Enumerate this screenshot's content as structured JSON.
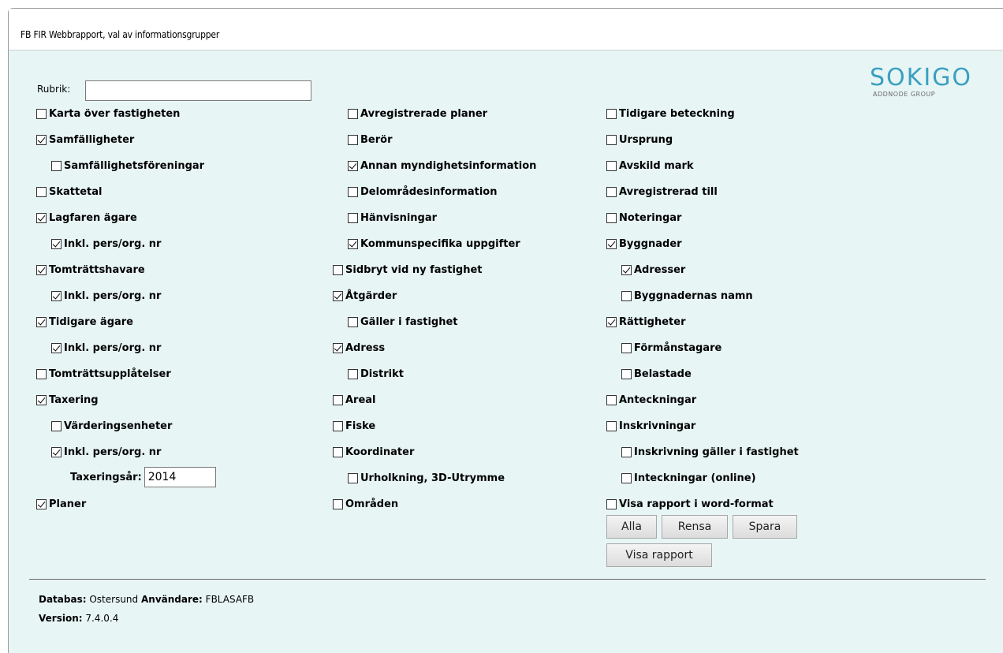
{
  "title": "FB FIR Webbrapport, val av informationsgrupper",
  "logo": {
    "word": "SOKIGO",
    "sub": "ADDNODE GROUP"
  },
  "rubrik": {
    "label": "Rubrik:",
    "value": ""
  },
  "col1": [
    {
      "label": "Karta över fastigheten",
      "checked": false
    },
    {
      "label": "Samfälligheter",
      "checked": true
    },
    {
      "label": "Samfällighetsföreningar",
      "checked": false
    },
    {
      "label": "Skattetal",
      "checked": false
    },
    {
      "label": "Lagfaren ägare",
      "checked": true
    },
    {
      "label": "Inkl. pers/org. nr",
      "checked": true
    },
    {
      "label": "Tomträttshavare",
      "checked": true
    },
    {
      "label": "Inkl. pers/org. nr",
      "checked": true
    },
    {
      "label": "Tidigare ägare",
      "checked": true
    },
    {
      "label": "Inkl. pers/org. nr",
      "checked": true
    },
    {
      "label": "Tomträttsupplåtelser",
      "checked": false
    },
    {
      "label": "Taxering",
      "checked": true
    },
    {
      "label": "Värderingsenheter",
      "checked": false
    },
    {
      "label": "Inkl. pers/org. nr",
      "checked": true
    },
    {
      "label": "Planer",
      "checked": true
    }
  ],
  "taxeringsar": {
    "label": "Taxeringsår:",
    "value": "2014"
  },
  "col2": [
    {
      "label": "Avregistrerade planer",
      "checked": false
    },
    {
      "label": "Berör",
      "checked": false
    },
    {
      "label": "Annan myndighetsinformation",
      "checked": true
    },
    {
      "label": "Delområdesinformation",
      "checked": false
    },
    {
      "label": "Hänvisningar",
      "checked": false
    },
    {
      "label": "Kommunspecifika uppgifter",
      "checked": true
    },
    {
      "label": "Sidbryt vid ny fastighet",
      "checked": false
    },
    {
      "label": "Åtgärder",
      "checked": true
    },
    {
      "label": "Gäller i fastighet",
      "checked": false
    },
    {
      "label": "Adress",
      "checked": true
    },
    {
      "label": "Distrikt",
      "checked": false
    },
    {
      "label": "Areal",
      "checked": false
    },
    {
      "label": "Fiske",
      "checked": false
    },
    {
      "label": "Koordinater",
      "checked": false
    },
    {
      "label": "Urholkning, 3D-Utrymme",
      "checked": false
    },
    {
      "label": "Områden",
      "checked": false
    }
  ],
  "col3": [
    {
      "label": "Tidigare beteckning",
      "checked": false
    },
    {
      "label": "Ursprung",
      "checked": false
    },
    {
      "label": "Avskild mark",
      "checked": false
    },
    {
      "label": "Avregistrerad till",
      "checked": false
    },
    {
      "label": "Noteringar",
      "checked": false
    },
    {
      "label": "Byggnader",
      "checked": true
    },
    {
      "label": "Adresser",
      "checked": true
    },
    {
      "label": "Byggnadernas namn",
      "checked": false
    },
    {
      "label": "Rättigheter",
      "checked": true
    },
    {
      "label": "Förmånstagare",
      "checked": false
    },
    {
      "label": "Belastade",
      "checked": false
    },
    {
      "label": "Anteckningar",
      "checked": false
    },
    {
      "label": "Inskrivningar",
      "checked": false
    },
    {
      "label": "Inskrivning gäller i fastighet",
      "checked": false
    },
    {
      "label": "Inteckningar (online)",
      "checked": false
    },
    {
      "label": "Visa rapport i word-format",
      "checked": false
    }
  ],
  "buttons": {
    "all": "Alla",
    "clear": "Rensa",
    "save": "Spara",
    "show": "Visa rapport"
  },
  "footer": {
    "db_label": "Databas:",
    "db_value": "Ostersund",
    "user_label": "Användare:",
    "user_value": "FBLASAFB",
    "version_label": "Version:",
    "version_value": "7.4.0.4"
  }
}
